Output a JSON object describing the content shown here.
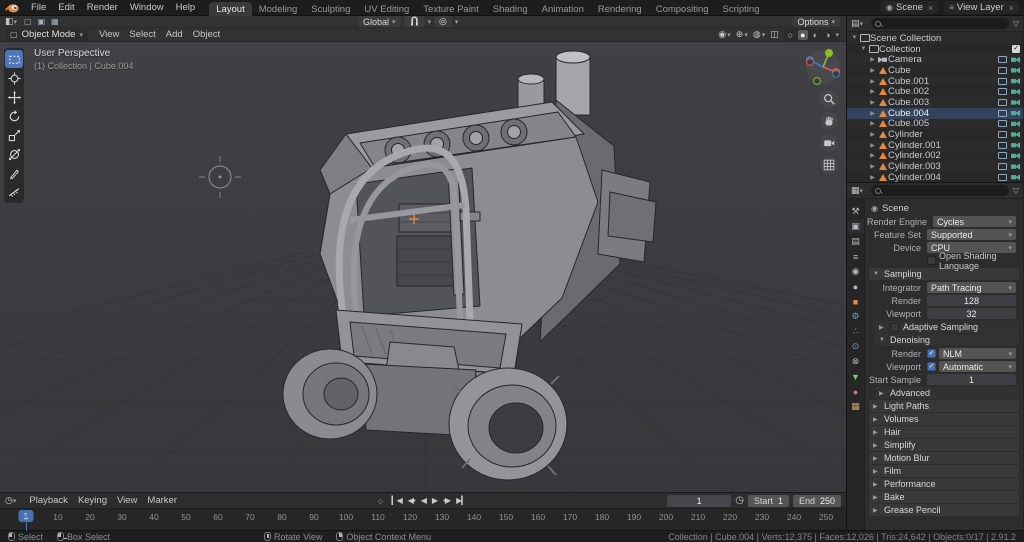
{
  "topbar": {
    "menus": [
      "File",
      "Edit",
      "Render",
      "Window",
      "Help"
    ],
    "tabs": [
      "Layout",
      "Modeling",
      "Sculpting",
      "UV Editing",
      "Texture Paint",
      "Shading",
      "Animation",
      "Rendering",
      "Compositing",
      "Scripting"
    ],
    "active_tab": "Layout",
    "scene": {
      "label": "Scene"
    },
    "view_layer": {
      "label": "View Layer"
    }
  },
  "tool_header": {
    "orientation": "Global",
    "options": "Options"
  },
  "viewport_header": {
    "mode": "Object Mode",
    "menus": [
      "View",
      "Select",
      "Add",
      "Object"
    ]
  },
  "viewport": {
    "overlay_title": "User Perspective",
    "overlay_subtitle": "(1) Collection | Cube.004",
    "tools": [
      {
        "name": "select-box",
        "active": true
      },
      {
        "name": "cursor"
      },
      {
        "name": "move"
      },
      {
        "name": "rotate"
      },
      {
        "name": "scale"
      },
      {
        "name": "transform"
      },
      {
        "name": "annotate"
      },
      {
        "name": "measure"
      }
    ],
    "nav_icons": [
      "zoom",
      "hand",
      "camera-view",
      "grid-toggle"
    ]
  },
  "outliner": {
    "rows": [
      {
        "label": "Scene Collection",
        "depth": 0,
        "disclosure": "▼",
        "type": "collection",
        "right": []
      },
      {
        "label": "Collection",
        "depth": 1,
        "disclosure": "▼",
        "type": "collection",
        "right": [
          "checkbox"
        ]
      },
      {
        "label": "Camera",
        "depth": 2,
        "disclosure": "▶",
        "type": "camera",
        "right": [
          "monitor",
          "camera"
        ]
      },
      {
        "label": "Cube",
        "depth": 2,
        "disclosure": "▶",
        "type": "mesh",
        "right": [
          "monitor",
          "camera"
        ]
      },
      {
        "label": "Cube.001",
        "depth": 2,
        "disclosure": "▶",
        "type": "mesh",
        "right": [
          "monitor",
          "camera"
        ]
      },
      {
        "label": "Cube.002",
        "depth": 2,
        "disclosure": "▶",
        "type": "mesh",
        "right": [
          "monitor",
          "camera"
        ]
      },
      {
        "label": "Cube.003",
        "depth": 2,
        "disclosure": "▶",
        "type": "mesh",
        "right": [
          "monitor",
          "camera"
        ]
      },
      {
        "label": "Cube.004",
        "depth": 2,
        "disclosure": "▶",
        "type": "mesh",
        "right": [
          "monitor",
          "camera"
        ],
        "active": true
      },
      {
        "label": "Cube.005",
        "depth": 2,
        "disclosure": "▶",
        "type": "mesh",
        "right": [
          "monitor",
          "camera"
        ]
      },
      {
        "label": "Cylinder",
        "depth": 2,
        "disclosure": "▶",
        "type": "mesh",
        "right": [
          "monitor",
          "camera"
        ]
      },
      {
        "label": "Cylinder.001",
        "depth": 2,
        "disclosure": "▶",
        "type": "mesh",
        "right": [
          "monitor",
          "camera"
        ]
      },
      {
        "label": "Cylinder.002",
        "depth": 2,
        "disclosure": "▶",
        "type": "mesh",
        "right": [
          "monitor",
          "camera"
        ]
      },
      {
        "label": "Cylinder.003",
        "depth": 2,
        "disclosure": "▶",
        "type": "mesh",
        "right": [
          "monitor",
          "camera"
        ]
      },
      {
        "label": "Cylinder.004",
        "depth": 2,
        "disclosure": "▶",
        "type": "mesh",
        "right": [
          "monitor",
          "camera"
        ]
      }
    ]
  },
  "properties": {
    "breadcrumb": "Scene",
    "tabs": [
      {
        "name": "tool"
      },
      {
        "name": "render",
        "active": true
      },
      {
        "name": "output"
      },
      {
        "name": "view-layer"
      },
      {
        "name": "scene"
      },
      {
        "name": "world"
      },
      {
        "name": "object"
      },
      {
        "name": "modifiers"
      },
      {
        "name": "particles"
      },
      {
        "name": "physics"
      },
      {
        "name": "constraints"
      },
      {
        "name": "data"
      },
      {
        "name": "material"
      },
      {
        "name": "texture"
      }
    ],
    "rows": [
      {
        "kind": "field",
        "label": "Render Engine",
        "value": "Cycles",
        "widget": "dropdown"
      },
      {
        "kind": "field",
        "label": "Feature Set",
        "value": "Supported",
        "widget": "dropdown"
      },
      {
        "kind": "field",
        "label": "Device",
        "value": "CPU",
        "widget": "dropdown"
      },
      {
        "kind": "check",
        "label": "Open Shading Language",
        "checked": false
      },
      {
        "kind": "section",
        "label": "Sampling",
        "arrow": "▼"
      },
      {
        "kind": "field",
        "label": "Integrator",
        "value": "Path Tracing",
        "widget": "dropdown"
      },
      {
        "kind": "field",
        "label": "Render",
        "value": "128",
        "widget": "number"
      },
      {
        "kind": "field",
        "label": "Viewport",
        "value": "32",
        "widget": "number"
      },
      {
        "kind": "subsection",
        "label": "Adaptive Sampling",
        "arrow": "▶",
        "checkbox": true,
        "checked": false
      },
      {
        "kind": "subsection",
        "label": "Denoising",
        "arrow": "▼"
      },
      {
        "kind": "checkfield",
        "label": "Render",
        "value": "NLM",
        "checked": true
      },
      {
        "kind": "checkfield",
        "label": "Viewport",
        "value": "Automatic",
        "checked": true
      },
      {
        "kind": "field",
        "label": "Start Sample",
        "value": "1",
        "widget": "number"
      },
      {
        "kind": "subsection",
        "label": "Advanced",
        "arrow": "▶"
      },
      {
        "kind": "section",
        "label": "Light Paths",
        "arrow": "▶"
      },
      {
        "kind": "section",
        "label": "Volumes",
        "arrow": "▶"
      },
      {
        "kind": "section",
        "label": "Hair",
        "arrow": "▶"
      },
      {
        "kind": "section",
        "label": "Simplify",
        "arrow": "▶"
      },
      {
        "kind": "section",
        "label": "Motion Blur",
        "arrow": "▶"
      },
      {
        "kind": "section",
        "label": "Film",
        "arrow": "▶"
      },
      {
        "kind": "section",
        "label": "Performance",
        "arrow": "▶"
      },
      {
        "kind": "section",
        "label": "Bake",
        "arrow": "▶"
      },
      {
        "kind": "section",
        "label": "Grease Pencil",
        "arrow": "▶"
      }
    ]
  },
  "timeline": {
    "menus": [
      "Playback",
      "Keying",
      "View",
      "Marker"
    ],
    "transport": [
      "jump-start",
      "prev-keyframe",
      "play-reverse",
      "play",
      "next-keyframe",
      "jump-end"
    ],
    "current_frame": "1",
    "start_label": "Start",
    "start_value": "1",
    "end_label": "End",
    "end_value": "250",
    "ticks": [
      "1",
      "10",
      "20",
      "30",
      "40",
      "50",
      "60",
      "70",
      "80",
      "90",
      "100",
      "110",
      "120",
      "130",
      "140",
      "150",
      "160",
      "170",
      "180",
      "190",
      "200",
      "210",
      "220",
      "230",
      "240",
      "250"
    ]
  },
  "statusbar": {
    "hints": [
      {
        "icon": "mouse-left",
        "label": "Select"
      },
      {
        "icon": "mouse-drag",
        "label": "Box Select"
      },
      {
        "icon": "mouse-middle",
        "label": "Rotate View",
        "gap": 140
      },
      {
        "icon": "mouse-right",
        "label": "Object Context Menu"
      }
    ],
    "info": "Collection | Cube.004 | Verts:12,375 | Faces:12,026 | Tris:24,642 | Objects:0/17 | 2.91.2"
  },
  "colors": {
    "accent": "#4772b3",
    "object_orange": "#e8883a"
  }
}
